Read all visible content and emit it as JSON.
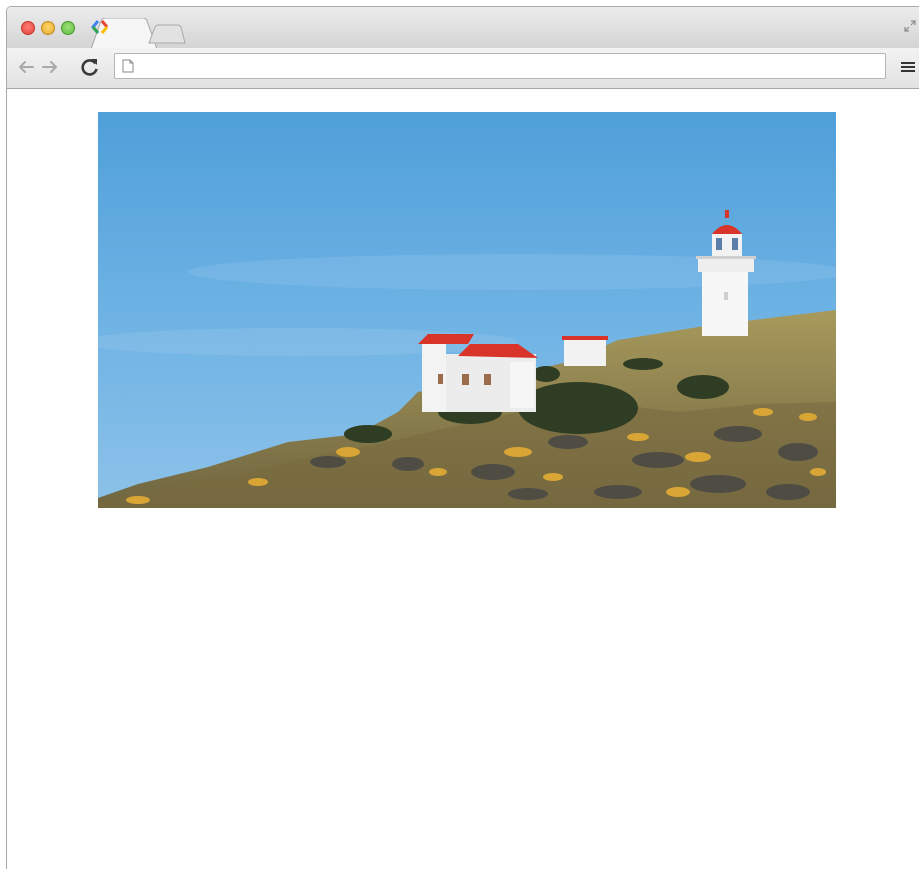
{
  "browser": {
    "tab": {
      "favicon": "google-developers-icon"
    },
    "toolbar": {
      "back_icon": "back-arrow-icon",
      "forward_icon": "forward-arrow-icon",
      "reload_icon": "reload-icon",
      "menu_icon": "hamburger-menu-icon",
      "page_icon": "blank-page-icon",
      "address_value": "",
      "address_placeholder": ""
    }
  },
  "page": {
    "image": {
      "subject": "lighthouse-on-grassy-headland-photo"
    }
  },
  "colors": {
    "sky": "#5aa8e0",
    "roof_red": "#d8342a",
    "grass": "#9b8a4a"
  }
}
